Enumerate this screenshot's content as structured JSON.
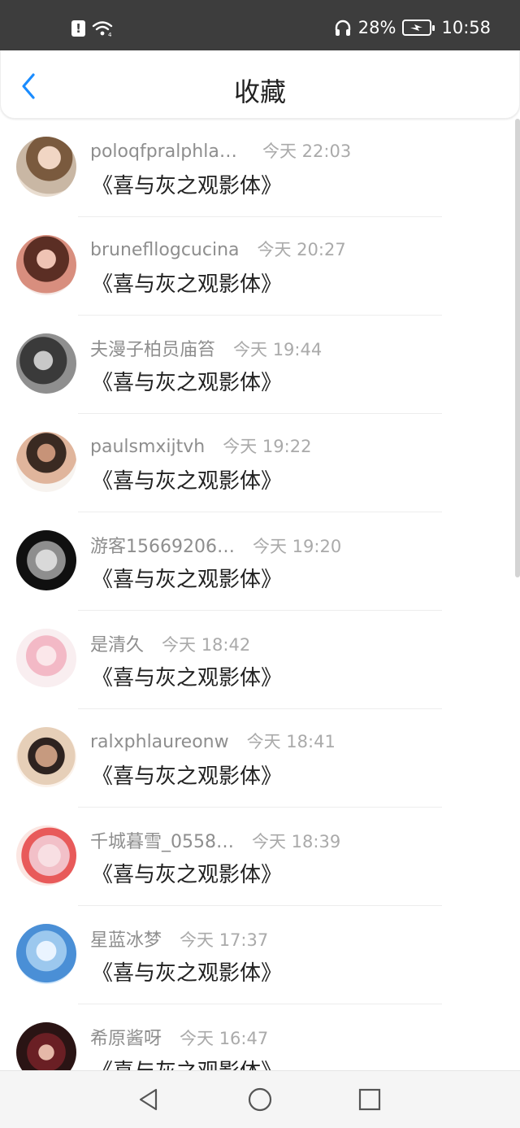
{
  "status_bar": {
    "battery_percent": "28%",
    "time": "10:58",
    "icons": [
      "alert-icon",
      "wifi-icon",
      "headphones-icon",
      "battery-charging-icon"
    ]
  },
  "header": {
    "title": "收藏",
    "back_icon": "chevron-left-icon",
    "accent_color": "#1a8cff"
  },
  "favorites": [
    {
      "username": "poloqfpralphlauren",
      "time": "今天 22:03",
      "movie": "《喜与灰之观影体》"
    },
    {
      "username": "brunefllogcucina",
      "time": "今天 20:27",
      "movie": "《喜与灰之观影体》"
    },
    {
      "username": "夫漫子柏员庙笞",
      "time": "今天 19:44",
      "movie": "《喜与灰之观影体》"
    },
    {
      "username": "paulsmxijtvh",
      "time": "今天 19:22",
      "movie": "《喜与灰之观影体》"
    },
    {
      "username": "游客15669206…",
      "time": "今天 19:20",
      "movie": "《喜与灰之观影体》"
    },
    {
      "username": "是清久",
      "time": "今天 18:42",
      "movie": "《喜与灰之观影体》"
    },
    {
      "username": "ralxphlaureonw",
      "time": "今天 18:41",
      "movie": "《喜与灰之观影体》"
    },
    {
      "username": "千城暮雪_0558…",
      "time": "今天 18:39",
      "movie": "《喜与灰之观影体》"
    },
    {
      "username": "星蓝冰梦",
      "time": "今天 17:37",
      "movie": "《喜与灰之观影体》"
    },
    {
      "username": "希原酱呀",
      "time": "今天 16:47",
      "movie": "《喜与灰之观影体》"
    }
  ],
  "nav_bar": {
    "icons": [
      "back-triangle-icon",
      "home-circle-icon",
      "recents-square-icon"
    ]
  }
}
